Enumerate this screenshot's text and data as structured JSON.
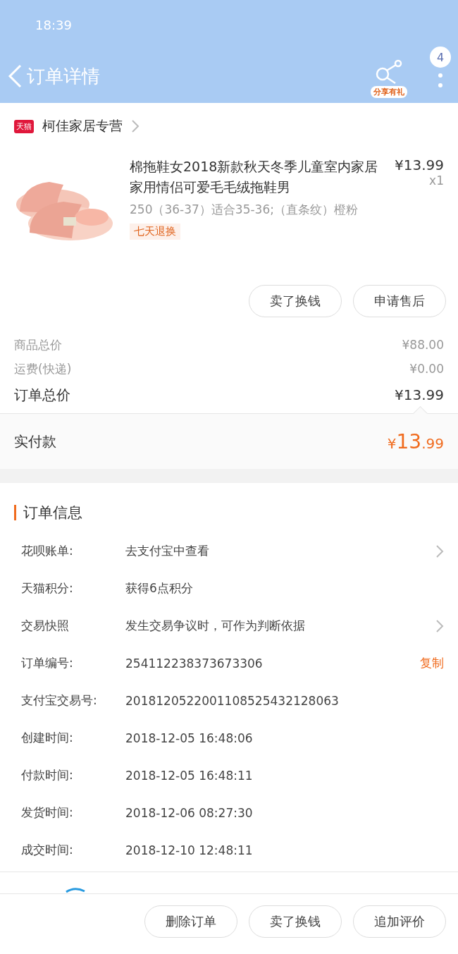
{
  "status_bar": {
    "time": "18:39"
  },
  "header": {
    "title": "订单详情",
    "share_label": "分享有礼",
    "badge": "4"
  },
  "shop": {
    "tag": "天猫",
    "name": "柯佳家居专营"
  },
  "product": {
    "title": "棉拖鞋女2018新款秋天冬季儿童室内家居家用情侣可爱毛毛绒拖鞋男",
    "price": "¥13.99",
    "quantity": "x1",
    "sku": "250（36-37）适合35-36;（直条纹）橙粉",
    "tag": "七天退换"
  },
  "product_actions": [
    "卖了换钱",
    "申请售后"
  ],
  "summary": [
    {
      "label": "商品总价",
      "value": "¥88.00",
      "kind": "minor"
    },
    {
      "label": "运费(快递)",
      "value": "¥0.00",
      "kind": "minor"
    },
    {
      "label": "订单总价",
      "value": "¥13.99",
      "kind": "major"
    }
  ],
  "paid": {
    "label": "实付款",
    "currency": "¥",
    "integer": "13",
    "decimal": ".99"
  },
  "order_info": {
    "title": "订单信息",
    "rows": [
      {
        "label": "花呗账单:",
        "value": "去支付宝中查看",
        "kind": "link"
      },
      {
        "label": "天猫积分:",
        "value": "获得6点积分",
        "kind": "plain"
      },
      {
        "label": "交易快照",
        "value": "发生交易争议时，可作为判断依据",
        "kind": "link"
      },
      {
        "label": "订单编号:",
        "value": "254112238373673306",
        "kind": "copy",
        "action": "复制"
      },
      {
        "label": "支付宝交易号:",
        "value": "2018120522001108525432128063",
        "kind": "plain"
      },
      {
        "label": "创建时间:",
        "value": "2018-12-05 16:48:06",
        "kind": "plain"
      },
      {
        "label": "付款时间:",
        "value": "2018-12-05 16:48:11",
        "kind": "plain"
      },
      {
        "label": "发货时间:",
        "value": "2018-12-06 08:27:30",
        "kind": "plain"
      },
      {
        "label": "成交时间:",
        "value": "2018-12-10 12:48:11",
        "kind": "plain"
      }
    ]
  },
  "bottom_actions": [
    "删除订单",
    "卖了换钱",
    "追加评价"
  ]
}
